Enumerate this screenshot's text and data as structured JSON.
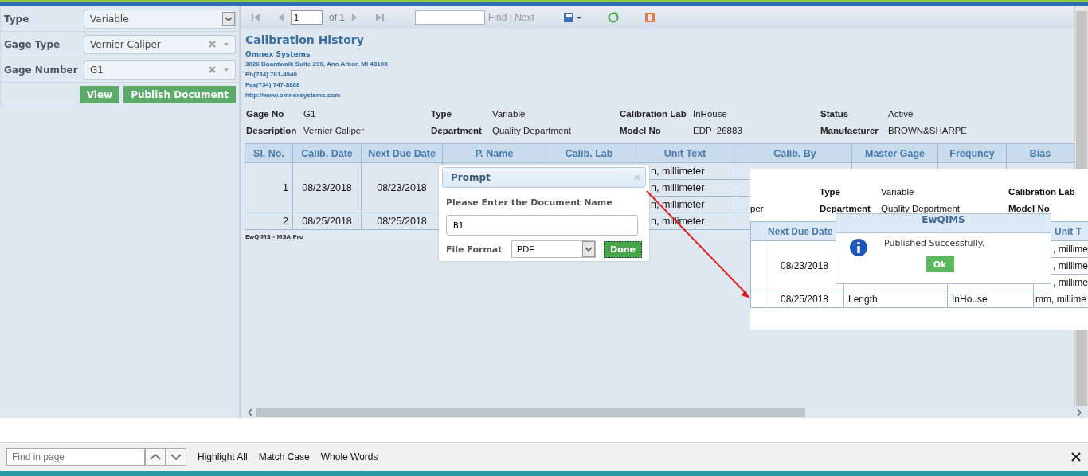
{
  "filters": [
    {
      "label": "Type",
      "value": "Variable",
      "kind": "select"
    },
    {
      "label": "Gage Type",
      "value": "Vernier Caliper",
      "kind": "combo"
    },
    {
      "label": "Gage Number",
      "value": "G1",
      "kind": "combo"
    }
  ],
  "filter_buttons": [
    "View",
    "Publish Document"
  ],
  "toolbar": {
    "page": "1",
    "page_count": "of 1",
    "find": "Find",
    "separator": "|",
    "next": "Next"
  },
  "report": {
    "title": "Calibration History",
    "company": "Omnex Systems",
    "address_lines": [
      "3026 Boardwalk  Suite 290, Ann Arbor, MI 48108",
      "Ph(734) 761-4940",
      "Fax(734) 747-8888",
      "http://www.omnexsystems.com"
    ],
    "details": [
      {
        "label": "Gage No",
        "value": "G1"
      },
      {
        "label": "Type",
        "value": "Variable"
      },
      {
        "label": "Calibration Lab",
        "value": "InHouse"
      },
      {
        "label": "Status",
        "value": "Active"
      },
      {
        "label": "Description",
        "value": "Vernier Caliper"
      },
      {
        "label": "Department",
        "value": "Quality Department"
      },
      {
        "label": "Model No",
        "value": "EDP  26883"
      },
      {
        "label": "Manufacturer",
        "value": "BROWN&SHARPE"
      }
    ],
    "table": {
      "columns": [
        "Sl. No.",
        "Calib. Date",
        "Next Due Date",
        "P. Name",
        "Calib. Lab",
        "Unit Text",
        "Calib. By",
        "Master Gage",
        "Frequncy",
        "Bias"
      ],
      "rows": [
        {
          "sl_no": "1",
          "calib_date": "08/23/2018",
          "next_due_date": "08/23/2018",
          "unit_text": [
            "n, millimeter",
            "n, millimeter",
            "n, millimeter"
          ]
        },
        {
          "sl_no": "2",
          "calib_date": "08/25/2018",
          "next_due_date": "08/25/2018",
          "unit_text": [
            "n, millimeter"
          ]
        }
      ]
    },
    "footer": "EwQIMS - MSA Pro"
  },
  "prompt": {
    "title": "Prompt",
    "label": "Please Enter the Document Name",
    "value": "B1",
    "format_label": "File Format",
    "format": "PDF",
    "button": "Done"
  },
  "inset": {
    "description_tail": "per",
    "details": [
      {
        "label": "Type",
        "value": "Variable"
      },
      {
        "label": "Calibration Lab"
      },
      {
        "label": "Department",
        "value": "Quality Department"
      },
      {
        "label": "Model No"
      }
    ],
    "columns": [
      "Next Due Date",
      "Unit T"
    ],
    "rows": [
      {
        "next_due_date": "08/23/2018",
        "unit_text": [
          ", millime",
          ", millime",
          ", millime"
        ]
      },
      {
        "next_due_date": "08/25/2018",
        "p_name": "Length",
        "calib_lab": "InHouse",
        "unit_text": [
          "mm, millime"
        ]
      }
    ]
  },
  "message": {
    "title": "EwQIMS",
    "text": "Published Successfully.",
    "button": "Ok"
  },
  "find_bar": {
    "placeholder": "Find in page",
    "options": [
      "Highlight All",
      "Match Case",
      "Whole Words"
    ]
  }
}
